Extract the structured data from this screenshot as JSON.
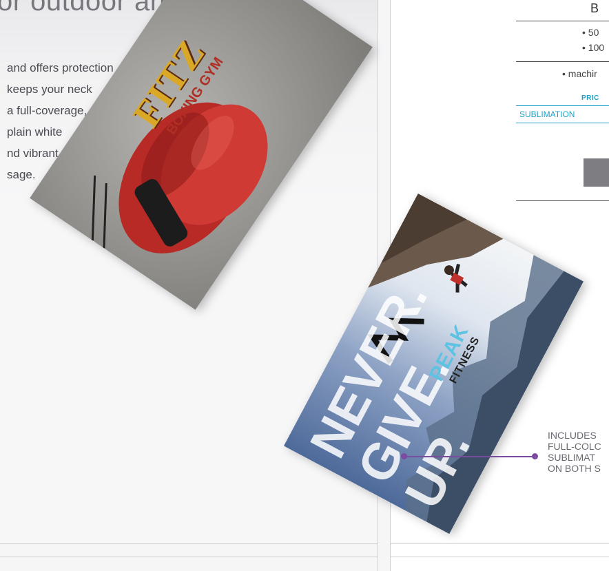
{
  "left": {
    "heading": "or outdoor and",
    "body_lines": [
      "and offers protection",
      "keeps your neck",
      "a full-coverage,",
      "plain white",
      "nd vibrant,",
      "sage."
    ]
  },
  "cards": {
    "boxing": {
      "logo_main": "FITZ",
      "logo_sub": "BOXING GYM"
    },
    "peak": {
      "slogan": [
        "NEVER.",
        "GIVE.",
        "UP."
      ],
      "logo_word": "PEAK",
      "logo_sub": "FITNESS"
    }
  },
  "right": {
    "heading": "B",
    "items": [
      "• 50",
      "• 100"
    ],
    "machine": "• machir",
    "price_label": "PRIC",
    "sublimation_label": "SUBLIMATION"
  },
  "callout": {
    "lines": [
      "INCLUDES",
      "FULL-COLC",
      "SUBLIMAT",
      "ON BOTH S"
    ]
  },
  "colors": {
    "accent": "#1ca0c9",
    "connector": "#7b4aa1",
    "glove": "#c0312d"
  }
}
